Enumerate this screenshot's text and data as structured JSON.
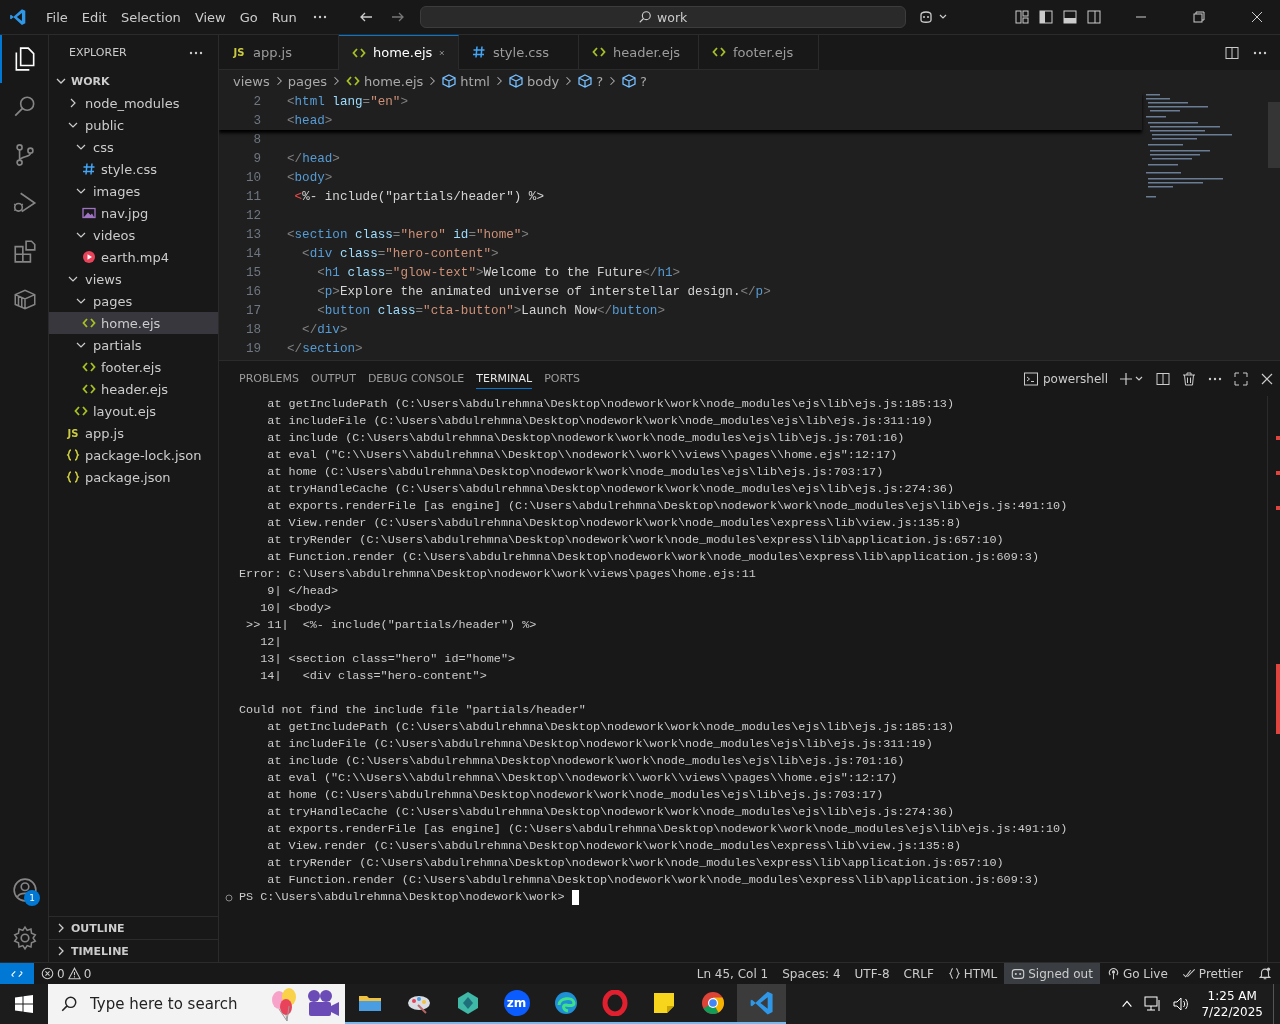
{
  "title_bar": {
    "menus": [
      "File",
      "Edit",
      "Selection",
      "View",
      "Go",
      "Run"
    ],
    "search": "work"
  },
  "activity_bar": {
    "items": [
      {
        "kind": "explorer",
        "selected": true
      },
      {
        "kind": "search",
        "selected": false
      },
      {
        "kind": "source-control",
        "selected": false
      },
      {
        "kind": "run-debug",
        "selected": false
      },
      {
        "kind": "extensions",
        "selected": false
      },
      {
        "kind": "remote",
        "selected": false
      }
    ],
    "account_badge": "1"
  },
  "sidebar": {
    "title": "EXPLORER",
    "section": "WORK",
    "tree": [
      {
        "label": "node_modules",
        "kind": "folder",
        "expanded": false,
        "selected": false
      },
      {
        "label": "public",
        "kind": "folder",
        "expanded": true,
        "selected": false,
        "children": [
          {
            "label": "css",
            "kind": "folder",
            "expanded": true,
            "selected": false,
            "children": [
              {
                "label": "style.css",
                "kind": "css",
                "selected": false
              }
            ]
          },
          {
            "label": "images",
            "kind": "folder",
            "expanded": true,
            "selected": false,
            "children": [
              {
                "label": "nav.jpg",
                "kind": "image",
                "selected": false
              }
            ]
          },
          {
            "label": "videos",
            "kind": "folder",
            "expanded": true,
            "selected": false,
            "children": [
              {
                "label": "earth.mp4",
                "kind": "video",
                "selected": false
              }
            ]
          }
        ]
      },
      {
        "label": "views",
        "kind": "folder",
        "expanded": true,
        "selected": false,
        "children": [
          {
            "label": "pages",
            "kind": "folder",
            "expanded": true,
            "selected": false,
            "children": [
              {
                "label": "home.ejs",
                "kind": "ejs",
                "selected": true
              }
            ]
          },
          {
            "label": "partials",
            "kind": "folder",
            "expanded": true,
            "selected": false,
            "children": [
              {
                "label": "footer.ejs",
                "kind": "ejs",
                "selected": false
              },
              {
                "label": "header.ejs",
                "kind": "ejs",
                "selected": false
              }
            ]
          },
          {
            "label": "layout.ejs",
            "kind": "ejs",
            "selected": false
          }
        ]
      },
      {
        "label": "app.js",
        "kind": "js",
        "icon_text": "JS",
        "selected": false
      },
      {
        "label": "package-lock.json",
        "kind": "json",
        "selected": false
      },
      {
        "label": "package.json",
        "kind": "json",
        "selected": false
      }
    ],
    "bottom_sections": [
      "OUTLINE",
      "TIMELINE"
    ]
  },
  "tabs": [
    {
      "label": "app.js",
      "kind": "js",
      "icon_text": "JS",
      "selected": false
    },
    {
      "label": "home.ejs",
      "kind": "ejs",
      "selected": true
    },
    {
      "label": "style.css",
      "kind": "css",
      "selected": false
    },
    {
      "label": "header.ejs",
      "kind": "ejs",
      "selected": false
    },
    {
      "label": "footer.ejs",
      "kind": "ejs",
      "selected": false
    }
  ],
  "breadcrumbs": [
    {
      "label": "views",
      "kind": "folder"
    },
    {
      "label": "pages",
      "kind": "folder"
    },
    {
      "label": "home.ejs",
      "kind": "ejs"
    },
    {
      "label": "html",
      "kind": "element"
    },
    {
      "label": "body",
      "kind": "element"
    },
    {
      "label": "?",
      "kind": "element"
    },
    {
      "label": "?",
      "kind": "element"
    }
  ],
  "editor": {
    "sticky_lines": [
      {
        "num": "2",
        "tokens": [
          {
            "kind": "punct",
            "text": "<"
          },
          {
            "kind": "tag",
            "text": "html"
          },
          {
            "kind": "attr",
            "text": " lang"
          },
          {
            "kind": "punct",
            "text": "="
          },
          {
            "kind": "str",
            "text": "\"en\""
          },
          {
            "kind": "punct",
            "text": ">"
          }
        ]
      },
      {
        "num": "3",
        "tokens": [
          {
            "kind": "punct",
            "text": "<"
          },
          {
            "kind": "tag",
            "text": "head"
          },
          {
            "kind": "punct",
            "text": ">"
          }
        ]
      }
    ],
    "lines": [
      {
        "num": "8"
      },
      {
        "num": "9",
        "tokens": [
          {
            "kind": "punct",
            "text": "</"
          },
          {
            "kind": "tag",
            "text": "head"
          },
          {
            "kind": "punct",
            "text": ">"
          }
        ]
      },
      {
        "num": "10",
        "tokens": [
          {
            "kind": "punct",
            "text": "<"
          },
          {
            "kind": "tag",
            "text": "body"
          },
          {
            "kind": "punct",
            "text": ">"
          }
        ]
      },
      {
        "num": "11",
        "tokens": [
          {
            "kind": "delim",
            "text": " <"
          },
          {
            "kind": "text",
            "text": "%- include(\"partials/header\") %>"
          }
        ]
      },
      {
        "num": "12"
      },
      {
        "num": "13",
        "tokens": [
          {
            "kind": "punct",
            "text": "<"
          },
          {
            "kind": "tag",
            "text": "section"
          },
          {
            "kind": "attr",
            "text": " class"
          },
          {
            "kind": "punct",
            "text": "="
          },
          {
            "kind": "str",
            "text": "\"hero\""
          },
          {
            "kind": "attr",
            "text": " id"
          },
          {
            "kind": "punct",
            "text": "="
          },
          {
            "kind": "str",
            "text": "\"home\""
          },
          {
            "kind": "punct",
            "text": ">"
          }
        ]
      },
      {
        "num": "14",
        "tokens": [
          {
            "kind": "punct",
            "text": "  <"
          },
          {
            "kind": "tag",
            "text": "div"
          },
          {
            "kind": "attr",
            "text": " class"
          },
          {
            "kind": "punct",
            "text": "="
          },
          {
            "kind": "str",
            "text": "\"hero-content\""
          },
          {
            "kind": "punct",
            "text": ">"
          }
        ]
      },
      {
        "num": "15",
        "tokens": [
          {
            "kind": "punct",
            "text": "    <"
          },
          {
            "kind": "tag",
            "text": "h1"
          },
          {
            "kind": "attr",
            "text": " class"
          },
          {
            "kind": "punct",
            "text": "="
          },
          {
            "kind": "str",
            "text": "\"glow-text\""
          },
          {
            "kind": "punct",
            "text": ">"
          },
          {
            "kind": "text",
            "text": "Welcome to the Future"
          },
          {
            "kind": "punct",
            "text": "</"
          },
          {
            "kind": "tag",
            "text": "h1"
          },
          {
            "kind": "punct",
            "text": ">"
          }
        ]
      },
      {
        "num": "16",
        "tokens": [
          {
            "kind": "punct",
            "text": "    <"
          },
          {
            "kind": "tag",
            "text": "p"
          },
          {
            "kind": "punct",
            "text": ">"
          },
          {
            "kind": "text",
            "text": "Explore the animated universe of interstellar design."
          },
          {
            "kind": "punct",
            "text": "</"
          },
          {
            "kind": "tag",
            "text": "p"
          },
          {
            "kind": "punct",
            "text": ">"
          }
        ]
      },
      {
        "num": "17",
        "tokens": [
          {
            "kind": "punct",
            "text": "    <"
          },
          {
            "kind": "tag",
            "text": "button"
          },
          {
            "kind": "attr",
            "text": " class"
          },
          {
            "kind": "punct",
            "text": "="
          },
          {
            "kind": "str",
            "text": "\"cta-button\""
          },
          {
            "kind": "punct",
            "text": ">"
          },
          {
            "kind": "text",
            "text": "Launch Now"
          },
          {
            "kind": "punct",
            "text": "</"
          },
          {
            "kind": "tag",
            "text": "button"
          },
          {
            "kind": "punct",
            "text": ">"
          }
        ]
      },
      {
        "num": "18",
        "tokens": [
          {
            "kind": "punct",
            "text": "  </"
          },
          {
            "kind": "tag",
            "text": "div"
          },
          {
            "kind": "punct",
            "text": ">"
          }
        ]
      },
      {
        "num": "19",
        "tokens": [
          {
            "kind": "punct",
            "text": "</"
          },
          {
            "kind": "tag",
            "text": "section"
          },
          {
            "kind": "punct",
            "text": ">"
          }
        ]
      }
    ]
  },
  "panel": {
    "tabs": [
      {
        "label": "PROBLEMS",
        "selected": false
      },
      {
        "label": "OUTPUT",
        "selected": false
      },
      {
        "label": "DEBUG CONSOLE",
        "selected": false
      },
      {
        "label": "TERMINAL",
        "selected": true
      },
      {
        "label": "PORTS",
        "selected": false
      }
    ],
    "shell": "powershell",
    "terminal_blocks": [
      {
        "lines": [
          {
            "text": "    at getIncludePath (C:\\Users\\abdulrehmna\\Desktop\\nodework\\work\\node_modules\\ejs\\lib\\ejs.js:185:13)"
          },
          {
            "text": "    at includeFile (C:\\Users\\abdulrehmna\\Desktop\\nodework\\work\\node_modules\\ejs\\lib\\ejs.js:311:19)"
          },
          {
            "text": "    at include (C:\\Users\\abdulrehmna\\Desktop\\nodework\\work\\node_modules\\ejs\\lib\\ejs.js:701:16)"
          },
          {
            "text": "    at eval (\"C:\\\\Users\\\\abdulrehmna\\\\Desktop\\\\nodework\\\\work\\\\views\\\\pages\\\\home.ejs\":12:17)"
          },
          {
            "text": "    at home (C:\\Users\\abdulrehmna\\Desktop\\nodework\\work\\node_modules\\ejs\\lib\\ejs.js:703:17)"
          },
          {
            "text": "    at tryHandleCache (C:\\Users\\abdulrehmna\\Desktop\\nodework\\work\\node_modules\\ejs\\lib\\ejs.js:274:36)"
          },
          {
            "text": "    at exports.renderFile [as engine] (C:\\Users\\abdulrehmna\\Desktop\\nodework\\work\\node_modules\\ejs\\lib\\ejs.js:491:10)"
          },
          {
            "text": "    at View.render (C:\\Users\\abdulrehmna\\Desktop\\nodework\\work\\node_modules\\express\\lib\\view.js:135:8)"
          },
          {
            "text": "    at tryRender (C:\\Users\\abdulrehmna\\Desktop\\nodework\\work\\node_modules\\express\\lib\\application.js:657:10)"
          },
          {
            "text": "    at Function.render (C:\\Users\\abdulrehmna\\Desktop\\nodework\\work\\node_modules\\express\\lib\\application.js:609:3)"
          },
          {
            "text": "Error: C:\\Users\\abdulrehmna\\Desktop\\nodework\\work\\views\\pages\\home.ejs:11"
          },
          {
            "text": "    9| </head>"
          },
          {
            "text": "   10| <body>"
          },
          {
            "text": " >> 11|  <%- include(\"partials/header\") %>"
          },
          {
            "text": "   12| "
          },
          {
            "text": "   13| <section class=\"hero\" id=\"home\">"
          },
          {
            "text": "   14|   <div class=\"hero-content\">"
          }
        ]
      },
      {
        "lines": [
          {
            "text": "Could not find the include file \"partials/header\""
          },
          {
            "text": "    at getIncludePath (C:\\Users\\abdulrehmna\\Desktop\\nodework\\work\\node_modules\\ejs\\lib\\ejs.js:185:13)"
          },
          {
            "text": "    at includeFile (C:\\Users\\abdulrehmna\\Desktop\\nodework\\work\\node_modules\\ejs\\lib\\ejs.js:311:19)"
          },
          {
            "text": "    at include (C:\\Users\\abdulrehmna\\Desktop\\nodework\\work\\node_modules\\ejs\\lib\\ejs.js:701:16)"
          },
          {
            "text": "    at eval (\"C:\\\\Users\\\\abdulrehmna\\\\Desktop\\\\nodework\\\\work\\\\views\\\\pages\\\\home.ejs\":12:17)"
          },
          {
            "text": "    at home (C:\\Users\\abdulrehmna\\Desktop\\nodework\\work\\node_modules\\ejs\\lib\\ejs.js:703:17)"
          },
          {
            "text": "    at tryHandleCache (C:\\Users\\abdulrehmna\\Desktop\\nodework\\work\\node_modules\\ejs\\lib\\ejs.js:274:36)"
          },
          {
            "text": "    at exports.renderFile [as engine] (C:\\Users\\abdulrehmna\\Desktop\\nodework\\work\\node_modules\\ejs\\lib\\ejs.js:491:10)"
          },
          {
            "text": "    at View.render (C:\\Users\\abdulrehmna\\Desktop\\nodework\\work\\node_modules\\express\\lib\\view.js:135:8)"
          },
          {
            "text": "    at tryRender (C:\\Users\\abdulrehmna\\Desktop\\nodework\\work\\node_modules\\express\\lib\\application.js:657:10)"
          },
          {
            "text": "    at Function.render (C:\\Users\\abdulrehmna\\Desktop\\nodework\\work\\node_modules\\express\\lib\\application.js:609:3)"
          }
        ]
      }
    ],
    "prompt": "PS C:\\Users\\abdulrehmna\\Desktop\\nodework\\work>"
  },
  "status_bar": {
    "errors": "0",
    "warnings": "0",
    "items": [
      {
        "kind": "plain",
        "label": "Ln 45, Col 1",
        "selected": false
      },
      {
        "kind": "plain",
        "label": "Spaces: 4",
        "selected": false
      },
      {
        "kind": "plain",
        "label": "UTF-8",
        "selected": false
      },
      {
        "kind": "plain",
        "label": "CRLF",
        "selected": false
      },
      {
        "kind": "language",
        "label": "HTML",
        "selected": false
      },
      {
        "kind": "account",
        "label": "Signed out",
        "selected": true
      },
      {
        "kind": "broadcast",
        "label": "Go Live",
        "selected": false
      },
      {
        "kind": "check",
        "label": "Prettier",
        "selected": false
      },
      {
        "kind": "bell",
        "selected": false
      }
    ]
  },
  "taskbar": {
    "search_placeholder": "Type here to search",
    "apps": [
      {
        "kind": "folder",
        "selected": false
      },
      {
        "kind": "palette",
        "selected": false
      },
      {
        "kind": "hexagon",
        "selected": false
      },
      {
        "kind": "video-call",
        "icon_text": "zm",
        "selected": false
      },
      {
        "kind": "swirl",
        "selected": false
      },
      {
        "kind": "ring",
        "selected": false
      },
      {
        "kind": "note",
        "selected": false
      },
      {
        "kind": "pinwheel",
        "selected": false
      },
      {
        "kind": "code-editor",
        "selected": true
      }
    ],
    "time": "1:25 AM",
    "date": "7/22/2025"
  }
}
